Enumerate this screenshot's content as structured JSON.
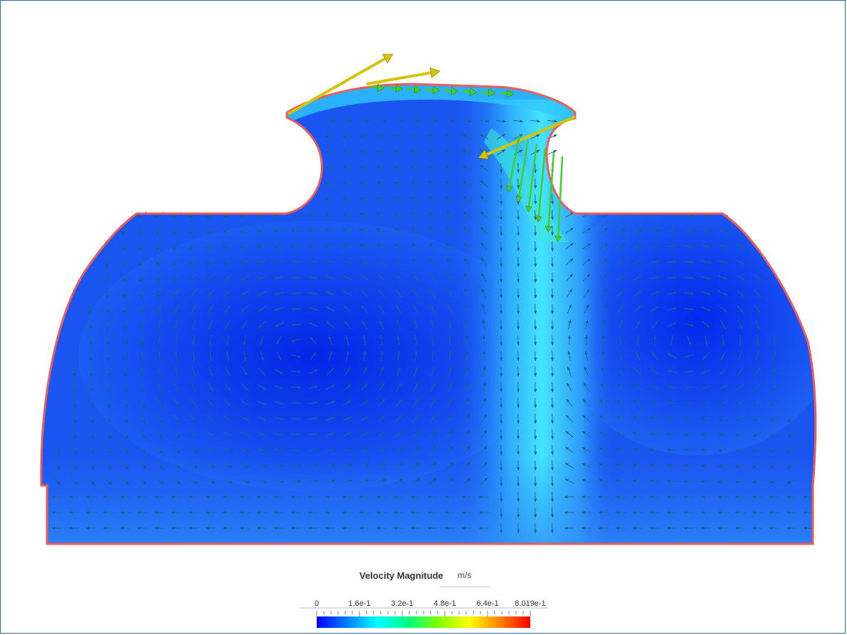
{
  "legend": {
    "title": "Velocity Magnitude",
    "unit": "m/s",
    "ticks": [
      "0",
      "1.6e-1",
      "3.2e-1",
      "4.8e-1",
      "6.4e-1",
      "8.019e-1"
    ],
    "colormap": [
      "#0000ff",
      "#0080ff",
      "#00ffff",
      "#00ff80",
      "#80ff00",
      "#ffff00",
      "#ff8000",
      "#ff0000"
    ]
  },
  "colors": {
    "fluid_base": "#1a55f0",
    "fluid_dark": "#0022e8",
    "jet": "#3fd8ff",
    "wall": "#f05050",
    "arrow_low": "#1e6a8c",
    "arrow_high_green": "#3ecf2a",
    "arrow_high_yellow": "#d6c400"
  }
}
